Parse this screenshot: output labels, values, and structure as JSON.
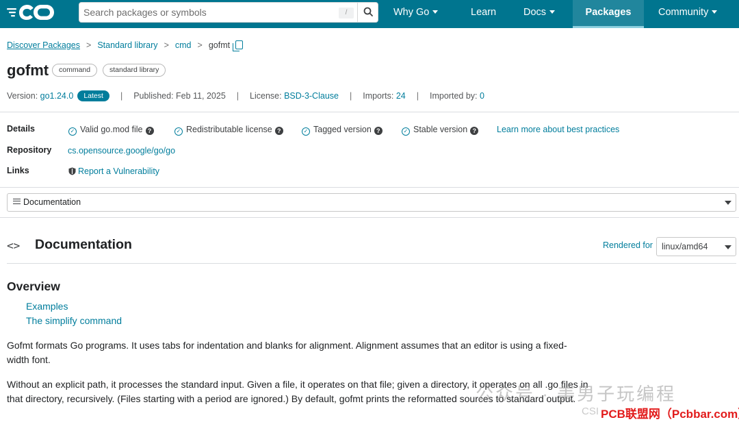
{
  "header": {
    "logo_text": "GO",
    "search_placeholder": "Search packages or symbols",
    "search_shortcut": "/",
    "nav": [
      "Why Go",
      "Learn",
      "Docs",
      "Packages",
      "Community"
    ]
  },
  "breadcrumb": [
    "Discover Packages",
    "Standard library",
    "cmd",
    "gofmt"
  ],
  "package": {
    "name": "gofmt",
    "chips": [
      "command",
      "standard library"
    ]
  },
  "meta": {
    "version_label": "Version:",
    "version": "go1.24.0",
    "latest": "Latest",
    "published_label": "Published: Feb 11, 2025",
    "license_label": "License:",
    "license": "BSD-3-Clause",
    "imports_label": "Imports:",
    "imports": "24",
    "imported_by_label": "Imported by:",
    "imported_by": "0"
  },
  "details": {
    "labels": [
      "Details",
      "Repository",
      "Links"
    ],
    "checks": [
      "Valid go.mod file",
      "Redistributable license",
      "Tagged version",
      "Stable version"
    ],
    "learn_more": "Learn more about best practices",
    "repository": "cs.opensource.google/go/go",
    "report": "Report a Vulnerability"
  },
  "doc_select": "Documentation",
  "documentation": {
    "heading": "Documentation",
    "rendered_for": "Rendered for",
    "platform": "linux/amd64",
    "overview": "Overview",
    "toc": [
      "Examples",
      "The simplify command"
    ],
    "paragraphs": [
      "Gofmt formats Go programs. It uses tabs for indentation and blanks for alignment. Alignment assumes that an editor is using a fixed-width font.",
      "Without an explicit path, it processes the standard input. Given a file, it operates on that file; given a directory, it operates on all .go files in that directory, recursively. (Files starting with a period are ignored.) By default, gofmt prints the reformatted sources to standard output."
    ]
  },
  "watermark": {
    "main": "公众号 · 美男子玩编程",
    "red": "PCB联盟网（Pcbbar.com）",
    "grey": "CSI"
  },
  "colors": {
    "brand": "#00758f",
    "link": "#007d9c"
  }
}
